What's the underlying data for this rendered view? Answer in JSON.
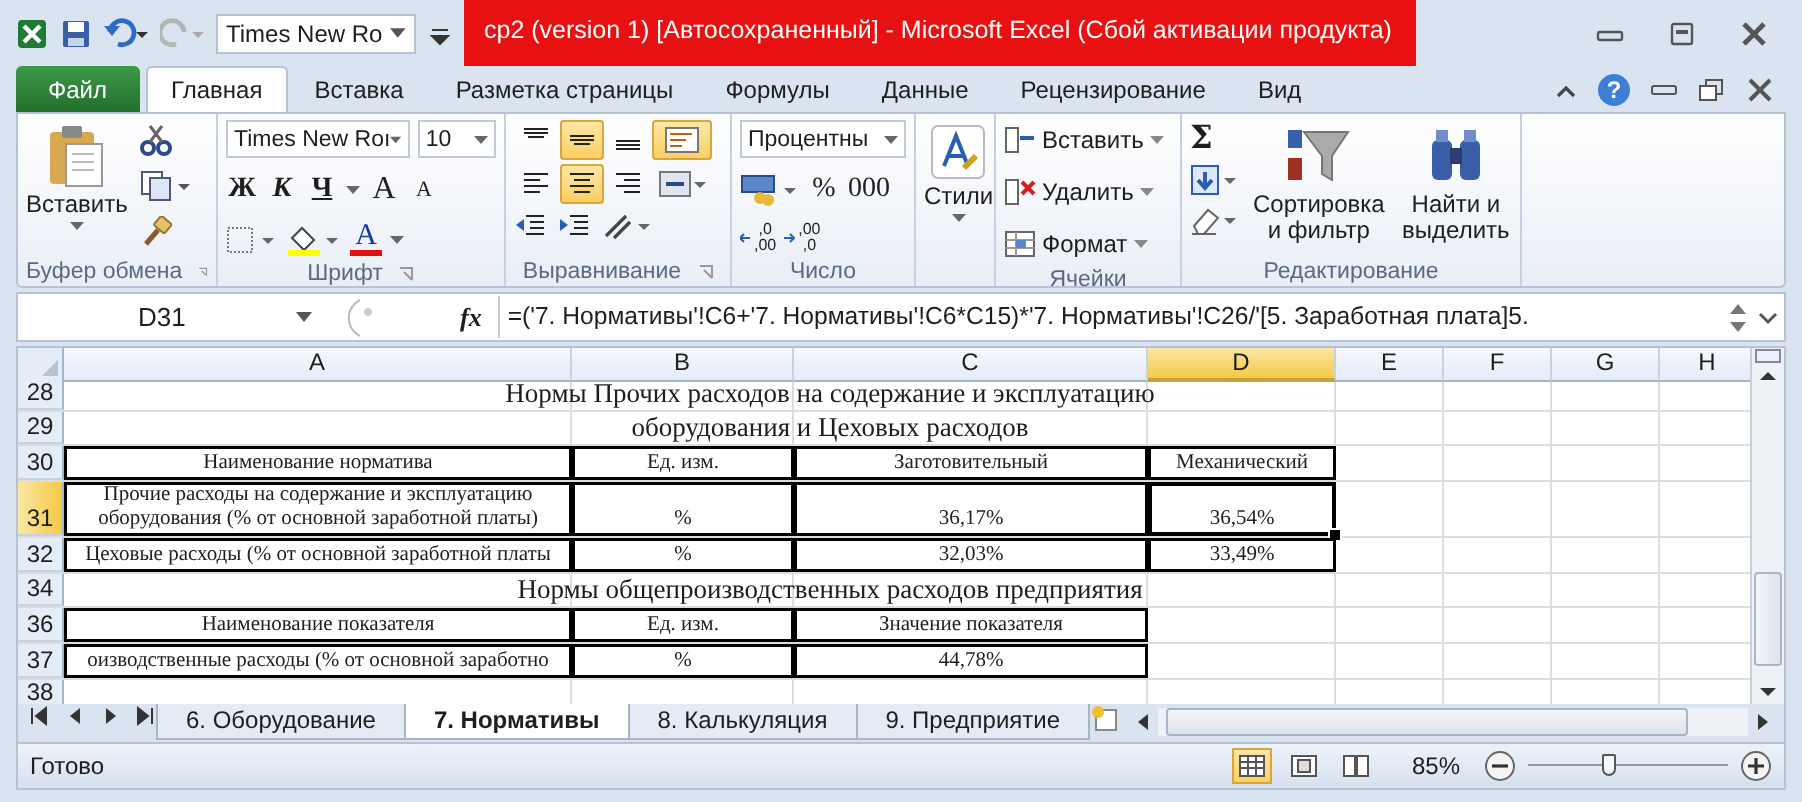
{
  "title_bar": {
    "font_box": "Times New Ro",
    "title": "cp2 (version 1) [Автосохраненный] - Microsoft Excel (Сбой активации продукта)"
  },
  "ribbon_tabs": [
    {
      "label": "Файл",
      "kind": "file",
      "selected": false
    },
    {
      "label": "Главная",
      "kind": "tab",
      "selected": true
    },
    {
      "label": "Вставка",
      "kind": "tab",
      "selected": false
    },
    {
      "label": "Разметка страницы",
      "kind": "tab",
      "selected": false
    },
    {
      "label": "Формулы",
      "kind": "tab",
      "selected": false
    },
    {
      "label": "Данные",
      "kind": "tab",
      "selected": false
    },
    {
      "label": "Рецензирование",
      "kind": "tab",
      "selected": false
    },
    {
      "label": "Вид",
      "kind": "tab",
      "selected": false
    }
  ],
  "help_label": "?",
  "clipboard": {
    "paste": "Вставить",
    "label": "Буфер обмена"
  },
  "font": {
    "name": "Times New Roı",
    "size": "10",
    "label": "Шрифт",
    "buttons": [
      {
        "label": "Ж",
        "kind": "bold"
      },
      {
        "label": "К",
        "kind": "italic"
      },
      {
        "label": "Ч",
        "kind": "underline"
      },
      {
        "label": "A",
        "kind": "grow"
      },
      {
        "label": "A",
        "kind": "shrink"
      }
    ],
    "color_label": "A"
  },
  "alignment": {
    "label": "Выравнивание",
    "buttons": [
      {
        "kind": "top",
        "selected": false
      },
      {
        "kind": "middle",
        "selected": true
      },
      {
        "kind": "bottom",
        "selected": false
      },
      {
        "kind": "wrap",
        "selected": true
      },
      {
        "kind": "left",
        "selected": false
      },
      {
        "kind": "center",
        "selected": true
      },
      {
        "kind": "right",
        "selected": false
      },
      {
        "kind": "merge",
        "selected": false
      }
    ]
  },
  "number": {
    "format": "Процентны",
    "percent": "%",
    "thousands": "000",
    "label": "Число",
    "decimals": [
      {
        "kind": "increase",
        "top": ",0",
        "bottom": ",00"
      },
      {
        "kind": "decrease",
        "top": ",00",
        "bottom": ",0"
      }
    ]
  },
  "styles": {
    "label": "Стили"
  },
  "cells": {
    "label": "Ячейки",
    "items": [
      {
        "label": "Вставить",
        "kind": "insert"
      },
      {
        "label": "Удалить",
        "kind": "delete"
      },
      {
        "label": "Формат",
        "kind": "format"
      }
    ]
  },
  "editing": {
    "label": "Редактирование",
    "sum": "Σ",
    "sort": "Сортировка и фильтр",
    "find": "Найти и выделить"
  },
  "formula_bar": {
    "name_box": "D31",
    "fx": "fx",
    "formula": "=('7. Нормативы'!C6+'7. Нормативы'!C6*C15)*'7. Нормативы'!C26/'[5. Заработная плата]5."
  },
  "columns": [
    {
      "label": "A",
      "selected": false
    },
    {
      "label": "B",
      "selected": false
    },
    {
      "label": "C",
      "selected": false
    },
    {
      "label": "D",
      "selected": true
    },
    {
      "label": "E",
      "selected": false
    },
    {
      "label": "F",
      "selected": false
    },
    {
      "label": "G",
      "selected": false
    },
    {
      "label": "H",
      "selected": false
    }
  ],
  "rows": [
    {
      "number": "28",
      "kind": "title",
      "selected": false,
      "cells": [
        "Нормы Прочих расходов на содержание и эксплуатацию"
      ]
    },
    {
      "number": "29",
      "kind": "title",
      "selected": false,
      "cells": [
        "оборудования и Цеховых расходов"
      ]
    },
    {
      "number": "30",
      "kind": "header",
      "selected": false,
      "cells": [
        "Наименование норматива",
        "Ед. изм.",
        "Заготовительный",
        "Механический"
      ]
    },
    {
      "number": "31",
      "kind": "data",
      "selected": true,
      "cells": [
        "Прочие расходы на содержание и эксплуатацию оборудования (% от основной заработной платы)",
        "%",
        "36,17%",
        "36,54%"
      ]
    },
    {
      "number": "32",
      "kind": "data",
      "selected": false,
      "cells": [
        "Цеховые расходы (% от основной заработной платы",
        "%",
        "32,03%",
        "33,49%"
      ]
    },
    {
      "number": "34",
      "kind": "title",
      "selected": false,
      "cells": [
        "Нормы общепроизводственных расходов предприятия"
      ]
    },
    {
      "number": "36",
      "kind": "header",
      "selected": false,
      "cells": [
        "Наименование показателя",
        "Ед. изм.",
        "Значение показателя"
      ]
    },
    {
      "number": "37",
      "kind": "data",
      "selected": false,
      "cells": [
        "оизводственные расходы (% от основной заработно",
        "%",
        "44,78%"
      ]
    },
    {
      "number": "38",
      "kind": "empty",
      "selected": false,
      "cells": []
    }
  ],
  "sheet_tabs": [
    {
      "label": "6. Оборудование",
      "selected": false
    },
    {
      "label": "7. Нормативы",
      "selected": true
    },
    {
      "label": "8. Калькуляция",
      "selected": false
    },
    {
      "label": "9. Предприятие",
      "selected": false
    }
  ],
  "status_bar": {
    "status": "Готово",
    "views": [
      {
        "kind": "normal",
        "selected": true
      },
      {
        "kind": "page_layout",
        "selected": false
      },
      {
        "kind": "page_break",
        "selected": false
      }
    ],
    "zoom": "85%",
    "zoom_slider": {
      "level": 0.4
    }
  }
}
